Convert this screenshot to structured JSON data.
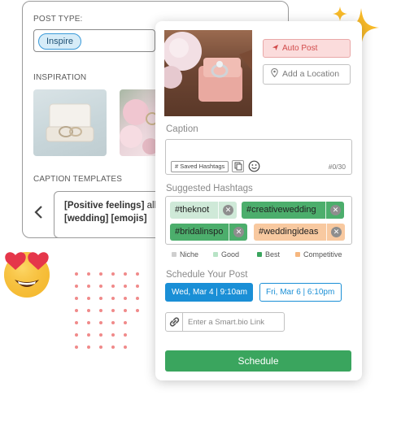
{
  "back_card": {
    "post_type_label": "POST TYPE:",
    "post_type_value": "Inspire",
    "inspiration_label": "INSPIRATION",
    "caption_templates_label": "CAPTION TEMPLATES",
    "template_line1_bold": "[Positive feelings]",
    "template_line1_rest": " all",
    "template_line2": "[wedding] [emojis]",
    "carousel_dots": 3,
    "carousel_active_index": 0
  },
  "post_card": {
    "auto_post_label": "Auto Post",
    "add_location_label": "Add a Location",
    "caption_label": "Caption",
    "saved_hashtags_label": "# Saved Hashtags",
    "char_count": "#0/30",
    "suggested_hashtags_label": "Suggested Hashtags",
    "hashtags": [
      {
        "tag": "#theknot",
        "category": "Good"
      },
      {
        "tag": "#creativewedding",
        "category": "Best"
      },
      {
        "tag": "#bridalinspo",
        "category": "Best"
      },
      {
        "tag": "#weddingideas",
        "category": "Competitive"
      }
    ],
    "legend": [
      {
        "label": "Niche",
        "color": "#cfcfcf"
      },
      {
        "label": "Good",
        "color": "#b8e3c6"
      },
      {
        "label": "Best",
        "color": "#3aa55e"
      },
      {
        "label": "Competitive",
        "color": "#f6b77f"
      }
    ],
    "schedule_label": "Schedule Your Post",
    "dates": [
      "Wed, Mar 4 | 9:10am",
      "Fri, Mar 6 | 6:10pm"
    ],
    "link_placeholder": "Enter a Smart.bio Link",
    "schedule_button": "Schedule"
  },
  "colors": {
    "accent_blue": "#1a8fd6",
    "schedule_green": "#3aa55e",
    "auto_post_red": "#d14a4a"
  },
  "icons": [
    "chevron-left-icon",
    "paper-plane-icon",
    "location-pin-icon",
    "copy-icon",
    "smile-icon",
    "close-icon",
    "link-icon",
    "sparkle-icon",
    "heart-eyes-emoji"
  ]
}
